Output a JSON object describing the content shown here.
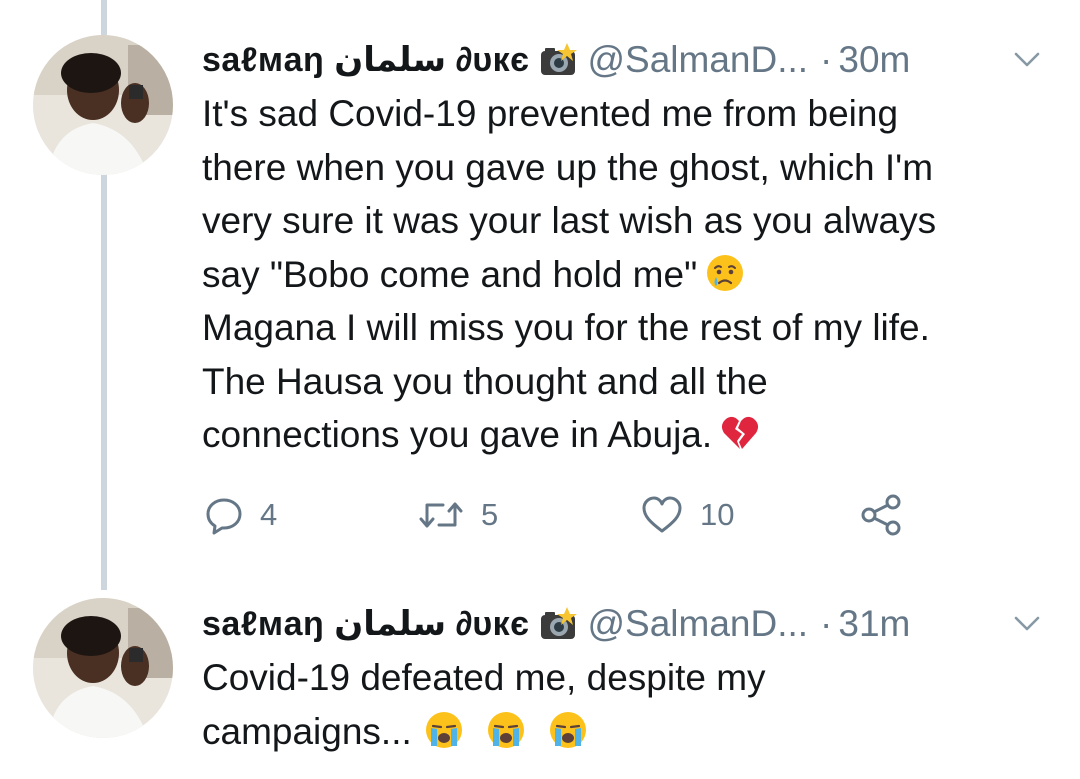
{
  "tweets": [
    {
      "name": "saℓмaŋ سلمان ∂υкє",
      "handle": "@SalmanD...",
      "dot": "·",
      "time": "30m",
      "lines": [
        "It's sad Covid-19 prevented me from being",
        "there when you gave up the ghost, which I'm",
        "very sure it was your last wish as you always",
        "say \"Bobo come and hold me\"",
        "Magana I will miss you for the rest of my life.",
        "The Hausa you thought and all the",
        "connections you gave in Abuja."
      ],
      "reply_count": "4",
      "retweet_count": "5",
      "like_count": "10"
    },
    {
      "name": "saℓмaŋ سلمان ∂υкє",
      "handle": "@SalmanD...",
      "dot": "·",
      "time": "31m",
      "lines": [
        "Covid-19 defeated me, despite my",
        "campaigns..."
      ]
    }
  ],
  "icons": {
    "reply": "reply-icon",
    "retweet": "retweet-icon",
    "like": "heart-icon",
    "share": "share-icon",
    "caret": "chevron-down-icon",
    "camera_flash": "camera-flash-emoji",
    "crying_face": "crying-face-emoji",
    "broken_heart": "broken-heart-emoji",
    "loudly_crying": "loudly-crying-face-emoji"
  },
  "colors": {
    "text": "#14171a",
    "secondary": "#657786",
    "thread_line": "#cdd6dd"
  }
}
